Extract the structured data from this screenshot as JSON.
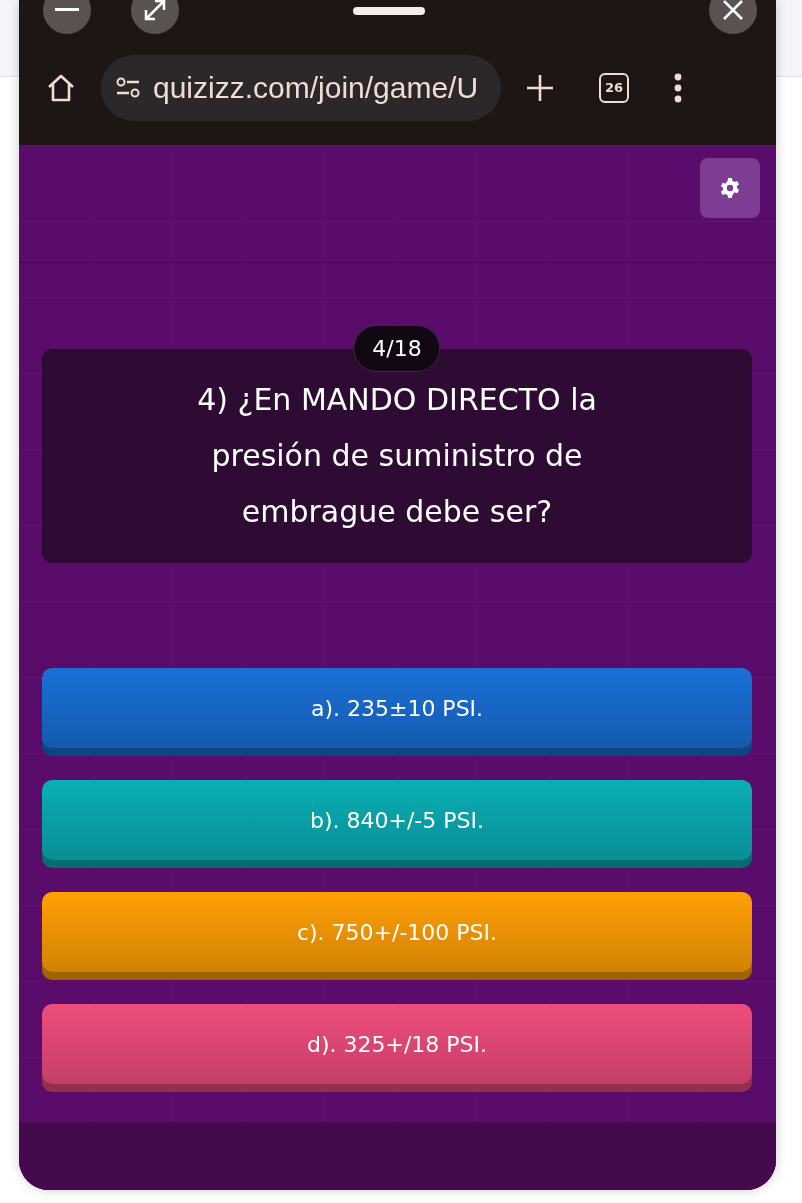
{
  "browser": {
    "url": "quizizz.com/join/game/U",
    "tab_count": "26"
  },
  "question": {
    "counter": "4/18",
    "text": "4) ¿En MANDO DIRECTO la presión de suministro de embrague debe ser?"
  },
  "options": [
    {
      "label": "a). 235±10 PSI.",
      "color": "#1a6fd6"
    },
    {
      "label": "b). 840+/-5 PSI.",
      "color": "#0aaeb5"
    },
    {
      "label": "c). 750+/-100 PSI.",
      "color": "#ff9f05"
    },
    {
      "label": "d). 325+/18 PSI.",
      "color": "#ef4d7c"
    }
  ]
}
